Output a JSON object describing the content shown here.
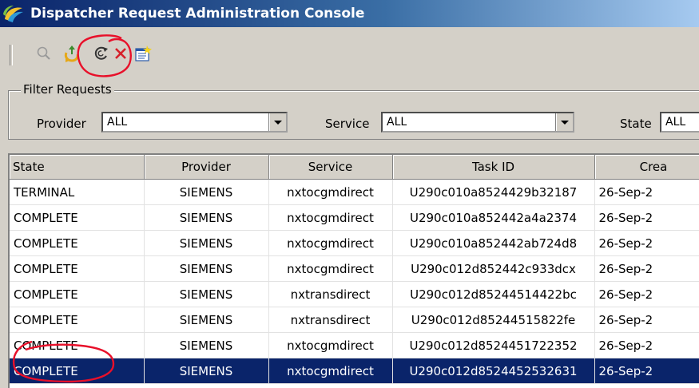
{
  "window": {
    "title": "Dispatcher Request Administration Console"
  },
  "toolbar": {
    "buttons": [
      {
        "name": "search-icon"
      },
      {
        "name": "retry-icon"
      },
      {
        "name": "refresh-icon"
      },
      {
        "name": "delete-icon"
      },
      {
        "name": "properties-icon"
      }
    ]
  },
  "filter": {
    "group_label": "Filter Requests",
    "provider": {
      "label": "Provider",
      "value": "ALL"
    },
    "service": {
      "label": "Service",
      "value": "ALL"
    },
    "state": {
      "label": "State",
      "value": "ALL"
    }
  },
  "table": {
    "columns": [
      "State",
      "Provider",
      "Service",
      "Task ID",
      "Crea"
    ],
    "rows": [
      [
        "TERMINAL",
        "SIEMENS",
        "nxtocgmdirect",
        "U290c010a8524429b32187",
        "26-Sep-2"
      ],
      [
        "COMPLETE",
        "SIEMENS",
        "nxtocgmdirect",
        "U290c010a852442a4a2374",
        "26-Sep-2"
      ],
      [
        "COMPLETE",
        "SIEMENS",
        "nxtocgmdirect",
        "U290c010a852442ab724d8",
        "26-Sep-2"
      ],
      [
        "COMPLETE",
        "SIEMENS",
        "nxtocgmdirect",
        "U290c012d852442c933dcx",
        "26-Sep-2"
      ],
      [
        "COMPLETE",
        "SIEMENS",
        "nxtransdirect",
        "U290c012d85244514422bc",
        "26-Sep-2"
      ],
      [
        "COMPLETE",
        "SIEMENS",
        "nxtransdirect",
        "U290c012d85244515822fe",
        "26-Sep-2"
      ],
      [
        "COMPLETE",
        "SIEMENS",
        "nxtocgmdirect",
        "U290c012d8524451722352",
        "26-Sep-2"
      ],
      [
        "COMPLETE",
        "SIEMENS",
        "nxtocgmdirect",
        "U290c012d8524452532631",
        "26-Sep-2"
      ]
    ],
    "selected_row": 7
  },
  "colors": {
    "title_bar": "#0a246a",
    "selection": "#0a246a",
    "annotation": "#e8102a"
  }
}
